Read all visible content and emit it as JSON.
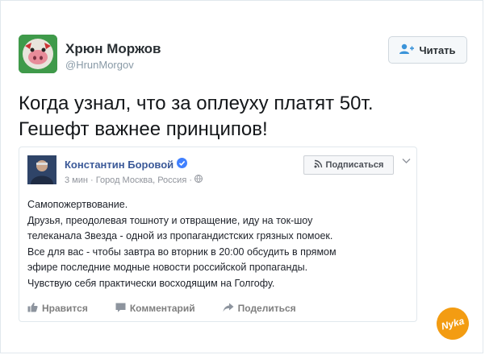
{
  "tweet": {
    "author_name": "Хрюн Моржов",
    "author_handle": "@HrunMorgov",
    "follow_label": "Читать",
    "text_line1": "Когда узнал, что за оплеуху платят 50т.",
    "text_line2": "Гешефт важнее принципов!"
  },
  "embedded_post": {
    "author_name": "Константин Боровой",
    "meta": "3 мин · Город Москва, Россия ·",
    "subscribe_label": "Подписаться",
    "body_lines": [
      "Самопожертвование.",
      "Друзья, преодолевая тошноту и отвращение, иду на ток-шоу",
      "телеканала Звезда - одной из пропагандистских грязных помоек.",
      "Все для вас - чтобы завтра во вторник в 20:00 обсудить в прямом",
      "эфире последние модные новости российской пропаганды.",
      "Чувствую себя практически восходящим на Голгофу."
    ],
    "actions": {
      "like": "Нравится",
      "comment": "Комментарий",
      "share": "Поделиться"
    }
  },
  "colors": {
    "fb_link": "#3b5998",
    "twitter_gray": "#8899a6",
    "verified": "#4080ff",
    "watermark": "#f39c12"
  }
}
